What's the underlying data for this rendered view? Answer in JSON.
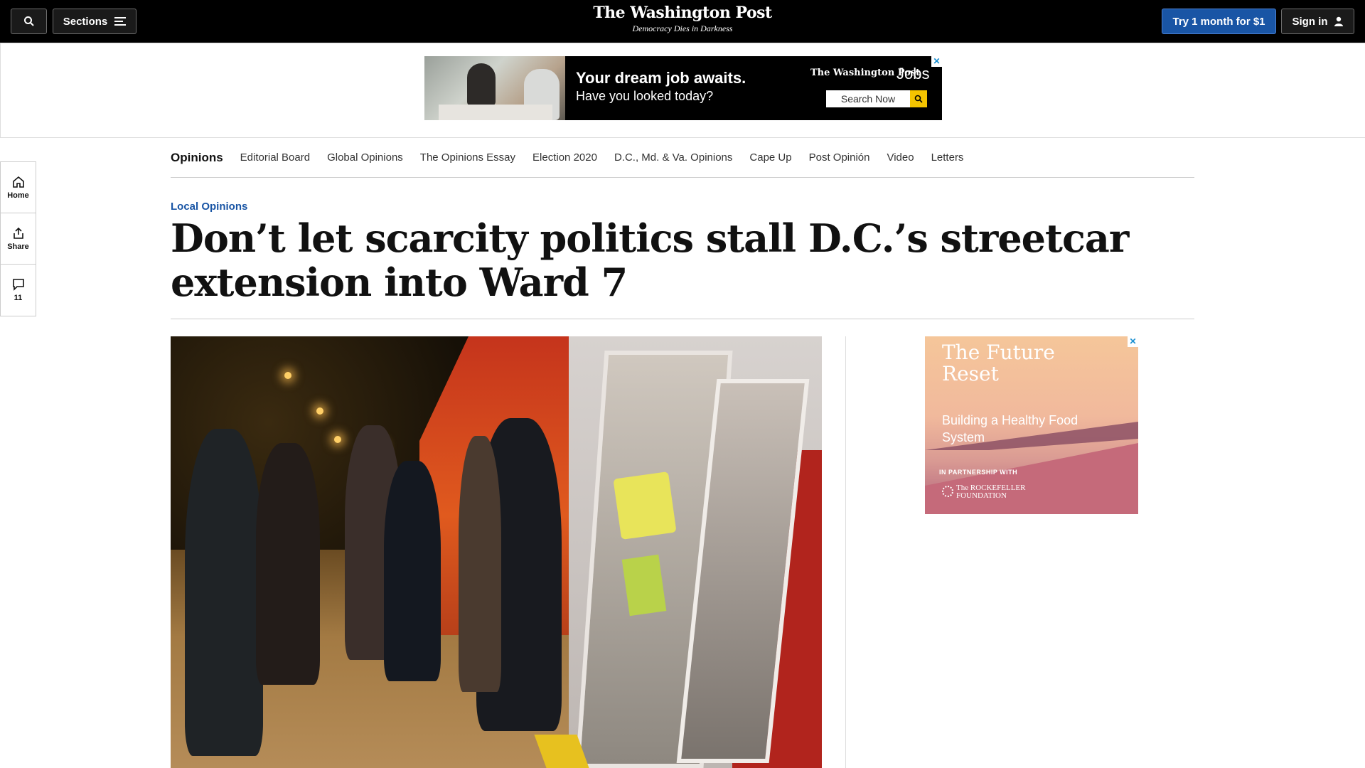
{
  "header": {
    "sections_label": "Sections",
    "logo_name": "The Washington Post",
    "logo_tagline": "Democracy Dies in Darkness",
    "subscribe_label": "Try 1 month for $1",
    "signin_label": "Sign in"
  },
  "top_ad": {
    "headline": "Your dream job awaits.",
    "subline": "Have you looked today?",
    "brand": "The Washington Post",
    "product": "Jobs",
    "search_label": "Search Now",
    "close_glyph": "✕"
  },
  "section_nav": {
    "title": "Opinions",
    "items": [
      "Editorial Board",
      "Global Opinions",
      "The Opinions Essay",
      "Election 2020",
      "D.C., Md. & Va. Opinions",
      "Cape Up",
      "Post Opinión",
      "Video",
      "Letters"
    ]
  },
  "rail": {
    "home_label": "Home",
    "share_label": "Share",
    "comments_count": "11"
  },
  "article": {
    "kicker": "Local Opinions",
    "headline": "Don’t let scarcity politics stall D.C.’s streetcar extension into Ward 7"
  },
  "side_ad": {
    "title": "The Future Reset",
    "subtitle": "Building a Healthy Food System",
    "partner_label": "IN PARTNERSHIP WITH",
    "foundation": "The ROCKEFELLER FOUNDATION",
    "close_glyph": "✕"
  },
  "colors": {
    "topbar": "#000000",
    "subscribe_button": "#1955a5",
    "kicker": "#1955a5",
    "ad_search_button": "#f4c400"
  },
  "icons": [
    "search-icon",
    "menu-icon",
    "user-icon",
    "home-icon",
    "share-icon",
    "comment-icon",
    "magnifier-icon",
    "close-icon"
  ]
}
